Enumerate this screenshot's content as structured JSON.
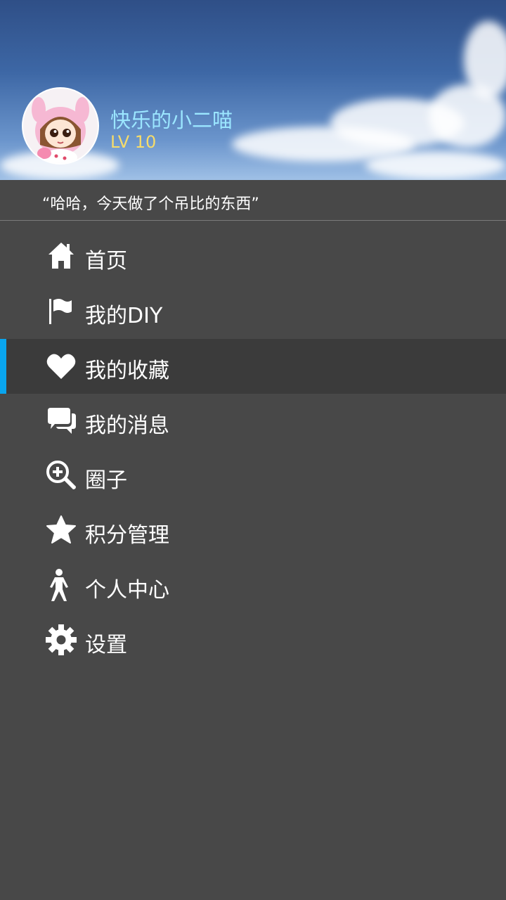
{
  "profile": {
    "username": "快乐的小二喵",
    "level": "LV 10",
    "signature": "“哈哈，今天做了个吊比的东西”"
  },
  "menu": {
    "items": [
      {
        "label": "首页",
        "icon": "home-icon"
      },
      {
        "label": "我的DIY",
        "icon": "flag-icon"
      },
      {
        "label": "我的收藏",
        "icon": "heart-icon",
        "selected": true
      },
      {
        "label": "我的消息",
        "icon": "chat-bubbles-icon"
      },
      {
        "label": "圈子",
        "icon": "zoom-in-icon"
      },
      {
        "label": "积分管理",
        "icon": "star-icon"
      },
      {
        "label": "个人中心",
        "icon": "person-icon"
      },
      {
        "label": "设置",
        "icon": "gear-icon"
      }
    ]
  },
  "colors": {
    "background": "#484848",
    "selected_background": "#3b3b3b",
    "accent": "#09a5ee",
    "username": "#9be6ff",
    "level": "#f6dc6a"
  }
}
